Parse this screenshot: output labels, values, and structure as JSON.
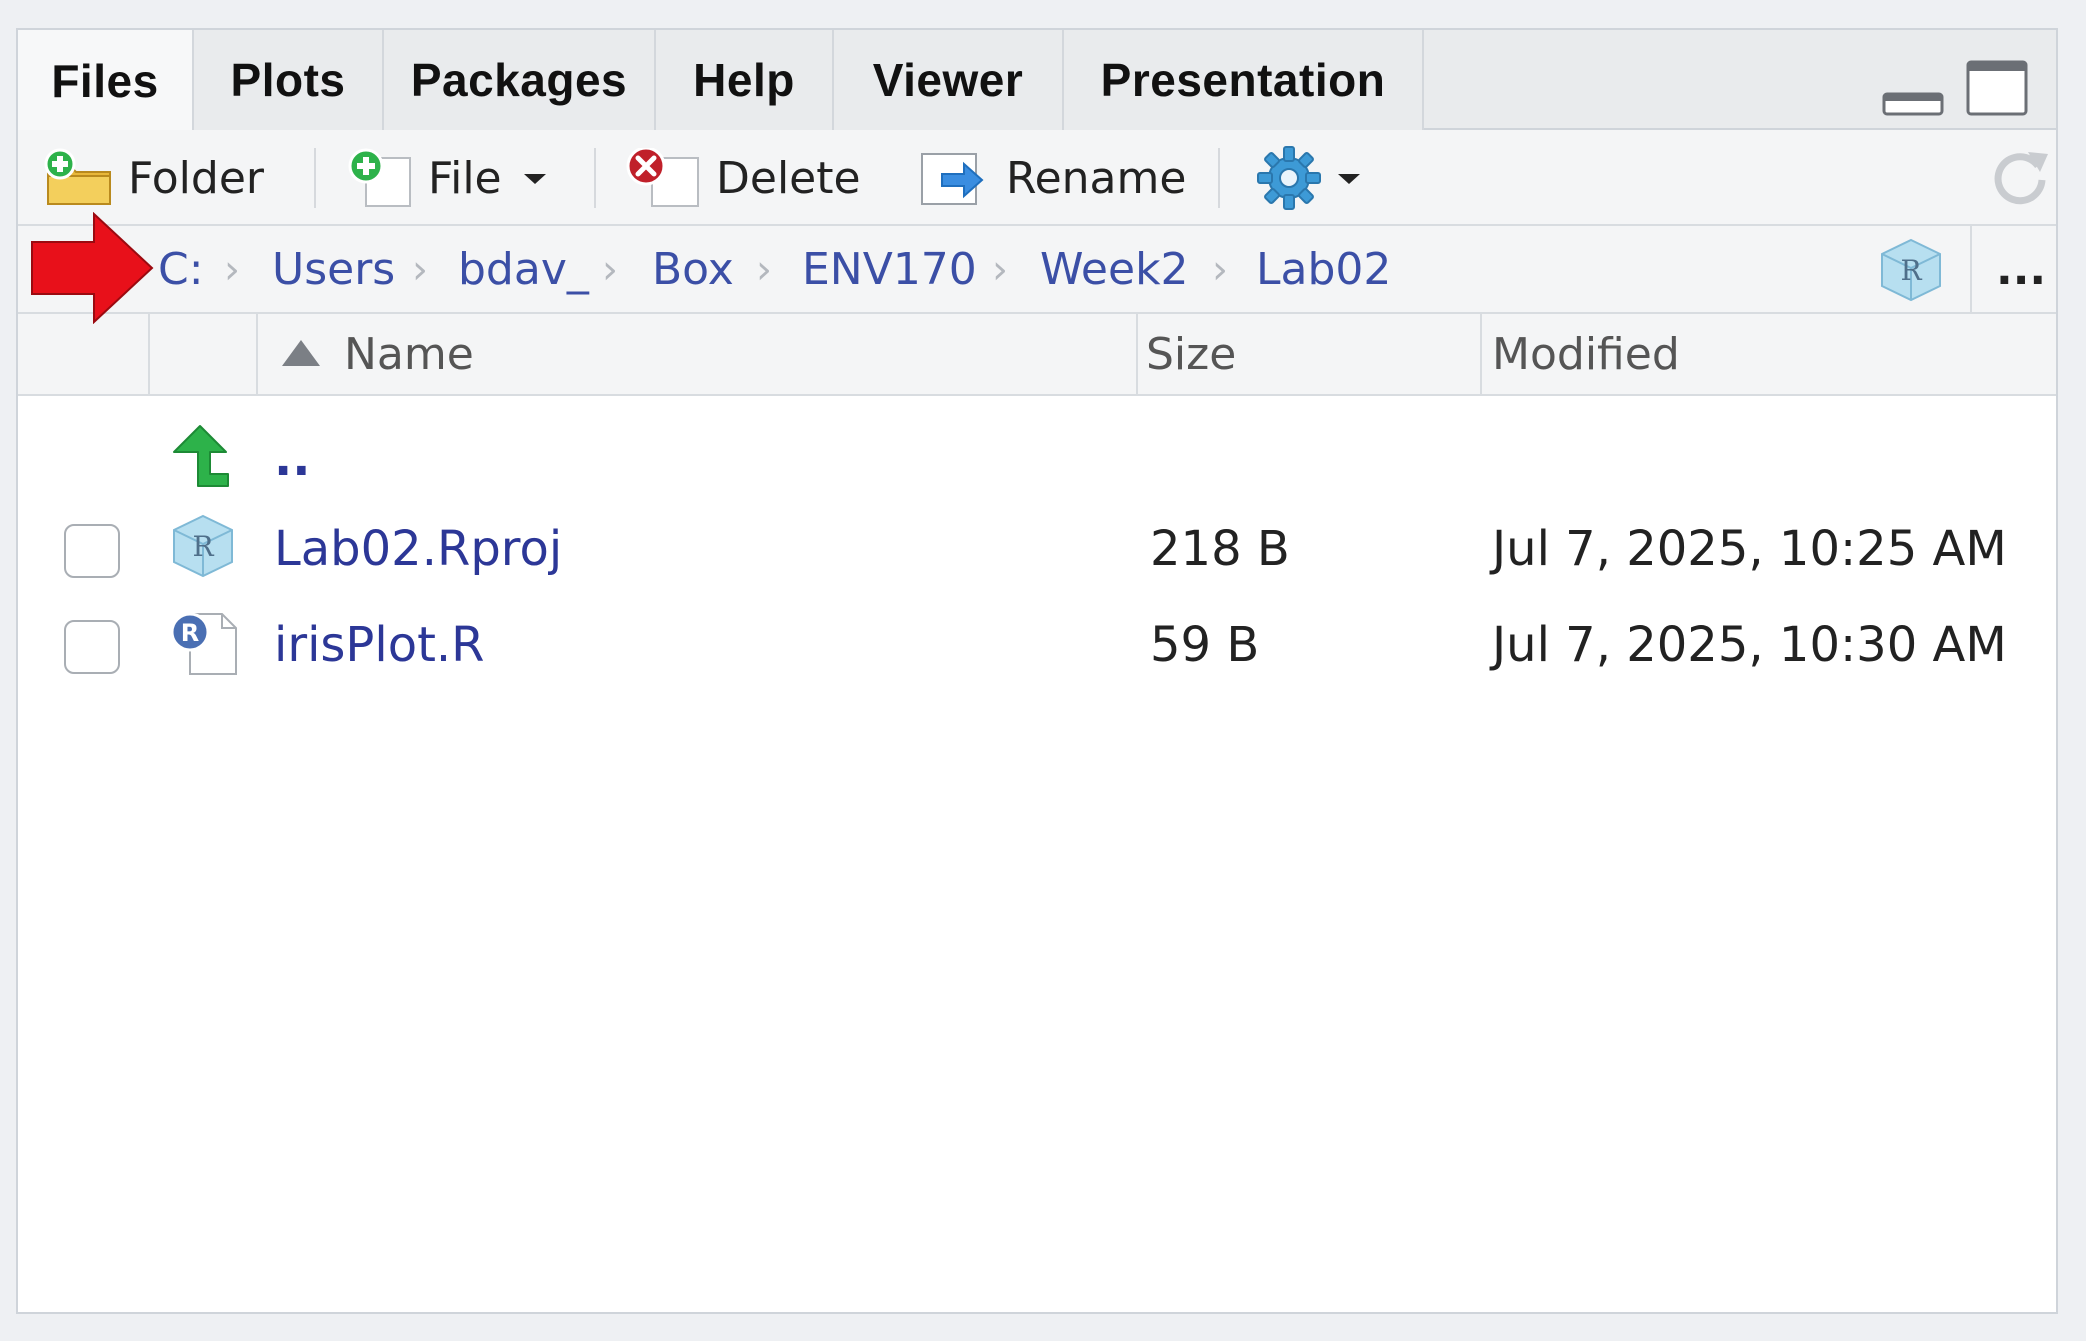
{
  "tabs": [
    {
      "label": "Files",
      "active": true
    },
    {
      "label": "Plots",
      "active": false
    },
    {
      "label": "Packages",
      "active": false
    },
    {
      "label": "Help",
      "active": false
    },
    {
      "label": "Viewer",
      "active": false
    },
    {
      "label": "Presentation",
      "active": false
    }
  ],
  "toolbar": {
    "new_folder": {
      "label": "Folder",
      "icon": "new-folder-icon"
    },
    "new_file": {
      "label": "File",
      "icon": "new-file-icon"
    },
    "delete": {
      "label": "Delete",
      "icon": "delete-icon"
    },
    "rename": {
      "label": "Rename",
      "icon": "rename-icon"
    },
    "more": {
      "icon": "gear-icon"
    },
    "refresh": {
      "icon": "refresh-icon"
    }
  },
  "breadcrumb": {
    "segments": [
      "C:",
      "Users",
      "bdav_",
      "Box",
      "ENV170",
      "Week2",
      "Lab02"
    ],
    "more_label": "..."
  },
  "columns": {
    "name": "Name",
    "size": "Size",
    "modified": "Modified",
    "sort": "ascending"
  },
  "files": [
    {
      "name": "..",
      "size": "",
      "modified": "",
      "icon": "parent-folder-icon"
    },
    {
      "name": "Lab02.Rproj",
      "size": "218 B",
      "modified": "Jul 7, 2025, 10:25 AM",
      "icon": "rproj-icon"
    },
    {
      "name": "irisPlot.R",
      "size": "59 B",
      "modified": "Jul 7, 2025, 10:30 AM",
      "icon": "r-script-icon"
    }
  ],
  "colors": {
    "link": "#3b4fa6",
    "file_link": "#2c3797",
    "arrow": "#e8101a",
    "accent_green": "#2db24a"
  }
}
